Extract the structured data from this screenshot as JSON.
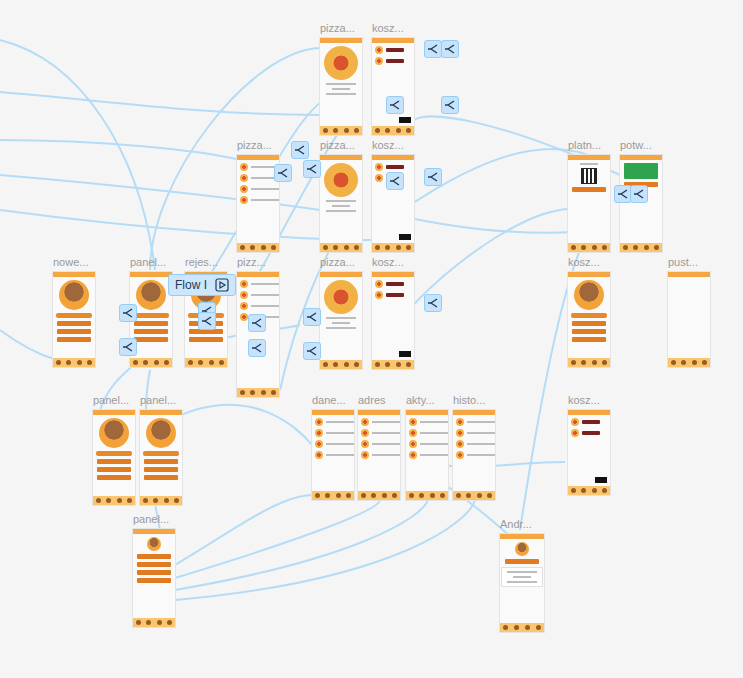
{
  "canvas": {
    "flow_label": "Flow I"
  },
  "frames": [
    {
      "label": "pizza...",
      "kind": "pizza"
    },
    {
      "label": "kosz...",
      "kind": "cart"
    },
    {
      "label": "pizza...",
      "kind": "list"
    },
    {
      "label": "pizza...",
      "kind": "pizza"
    },
    {
      "label": "kosz...",
      "kind": "cart"
    },
    {
      "label": "platn...",
      "kind": "payment"
    },
    {
      "label": "potw...",
      "kind": "confirm"
    },
    {
      "label": "nowe...",
      "kind": "logo"
    },
    {
      "label": "panel...",
      "kind": "logo"
    },
    {
      "label": "rejes...",
      "kind": "logo"
    },
    {
      "label": "pizz...",
      "kind": "list"
    },
    {
      "label": "pizza...",
      "kind": "pizza"
    },
    {
      "label": "kosz...",
      "kind": "cart"
    },
    {
      "label": "kosz...",
      "kind": "logo"
    },
    {
      "label": "pust...",
      "kind": "blank"
    },
    {
      "label": "panel...",
      "kind": "logo"
    },
    {
      "label": "panel...",
      "kind": "logo"
    },
    {
      "label": "dane...",
      "kind": "list"
    },
    {
      "label": "adres",
      "kind": "list"
    },
    {
      "label": "akty...",
      "kind": "list"
    },
    {
      "label": "histo...",
      "kind": "list"
    },
    {
      "label": "kosz...",
      "kind": "cart"
    },
    {
      "label": "panel...",
      "kind": "menu"
    },
    {
      "label": "Andr...",
      "kind": "status"
    }
  ]
}
